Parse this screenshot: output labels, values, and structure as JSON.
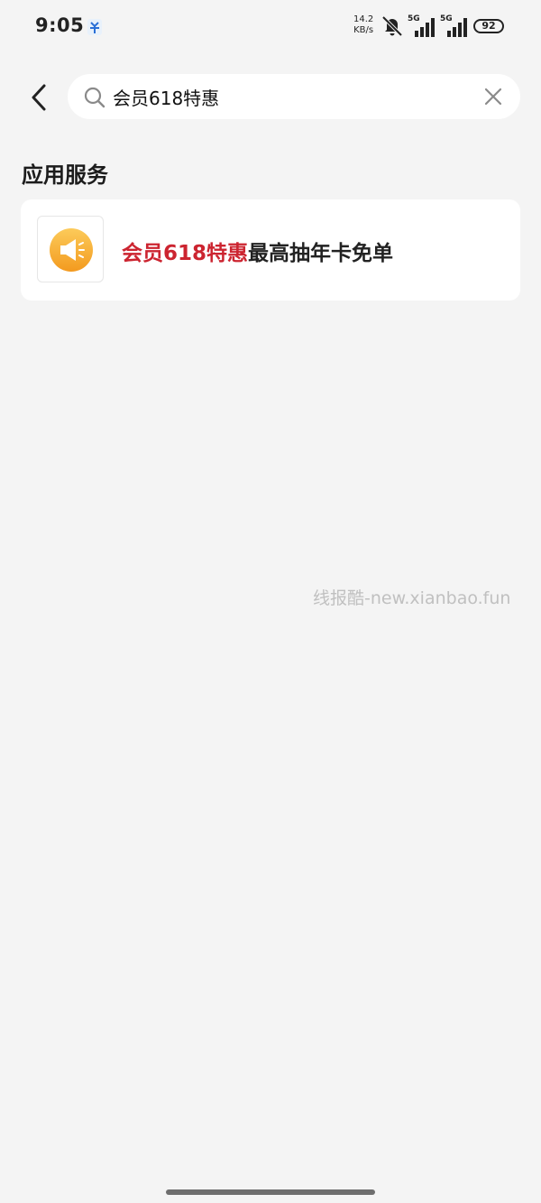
{
  "status_bar": {
    "time": "9:05",
    "net_speed_value": "14.2",
    "net_speed_unit": "KB/s",
    "sim1_label": "5G",
    "sim2_label": "5G",
    "battery": "92",
    "notification_icon": "app-notification-icon",
    "mute_icon": "bell-muted-icon"
  },
  "search": {
    "query": "会员618特惠",
    "back_icon": "chevron-left-icon",
    "search_icon": "search-icon",
    "clear_icon": "close-icon"
  },
  "section": {
    "title": "应用服务"
  },
  "results": [
    {
      "icon": "megaphone-icon",
      "icon_color": "#f5a623",
      "title_highlight": "会员618特惠",
      "title_rest": "最高抽年卡免单",
      "highlight_color": "#cc2430"
    }
  ],
  "watermark": "线报酷-new.xianbao.fun"
}
